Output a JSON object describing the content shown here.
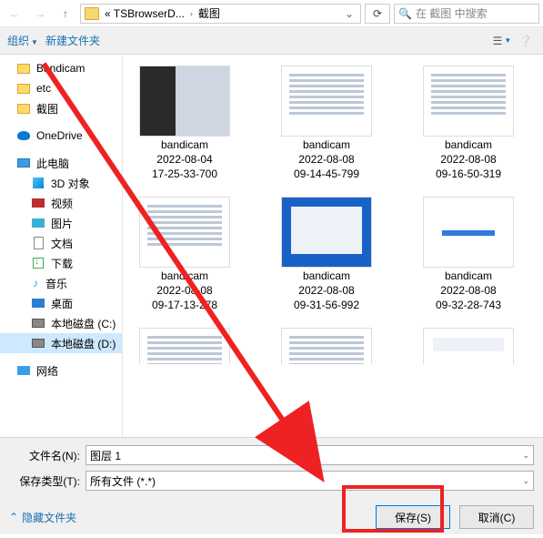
{
  "path": {
    "crumb1": "« TSBrowserD...",
    "crumb2": "截图"
  },
  "search": {
    "placeholder": "在 截图 中搜索"
  },
  "toolbar": {
    "organize": "组织",
    "newfolder": "新建文件夹"
  },
  "tree": {
    "bandicam": "Bandicam",
    "etc": "etc",
    "jietu": "截图",
    "onedrive": "OneDrive",
    "thispc": "此电脑",
    "obj3d": "3D 对象",
    "video": "视频",
    "pictures": "图片",
    "docs": "文档",
    "downloads": "下载",
    "music": "音乐",
    "desktop": "桌面",
    "diskc": "本地磁盘 (C:)",
    "diskd": "本地磁盘 (D:)",
    "network": "网络"
  },
  "files": [
    {
      "n1": "bandicam",
      "n2": "2022-08-04",
      "n3": "17-25-33-700",
      "t": "dark"
    },
    {
      "n1": "bandicam",
      "n2": "2022-08-08",
      "n3": "09-14-45-799",
      "t": "doc-like"
    },
    {
      "n1": "bandicam",
      "n2": "2022-08-08",
      "n3": "09-16-50-319",
      "t": "doc-like"
    },
    {
      "n1": "bandicam",
      "n2": "2022-08-08",
      "n3": "09-17-13-278",
      "t": "doc-like"
    },
    {
      "n1": "bandicam",
      "n2": "2022-08-08",
      "n3": "09-31-56-992",
      "t": "win"
    },
    {
      "n1": "bandicam",
      "n2": "2022-08-08",
      "n3": "09-32-28-743",
      "t": "white"
    }
  ],
  "partials": [
    {
      "t": "doc-like"
    },
    {
      "t": "doc-like"
    },
    {
      "t": "win"
    }
  ],
  "bottom": {
    "filename_label": "文件名(N):",
    "filename_value": "图层 1",
    "filetype_label": "保存类型(T):",
    "filetype_value": "所有文件 (*.*)",
    "hide": "隐藏文件夹",
    "save": "保存(S)",
    "cancel": "取消(C)"
  }
}
